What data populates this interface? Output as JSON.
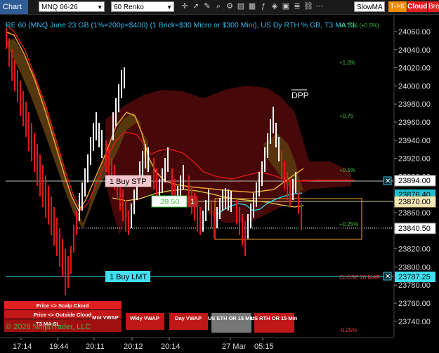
{
  "toolbar": {
    "title": "Chart",
    "instrument": "MNQ 06-26",
    "bar_type": "60 Renko",
    "indicator": "SlowMA",
    "tok_button": "T->K",
    "cloud_button": "Cloud",
    "break_button": "Brea",
    "icons": [
      "crosshair-icon",
      "pointer-icon",
      "draw-icon",
      "zoom-icon",
      "properties-icon",
      "data-box-icon",
      "templates-icon",
      "indicators-icon",
      "strategies-icon",
      "snapshot-icon",
      "dom-icon",
      "link-icon",
      "more-icon"
    ]
  },
  "banner": "RE 60 (MNQ June 23 GB (1%=200p=$400) (1 Brick=$30 Micro or $300 Mini), US Dy RTH % GB, T3 MA SL",
  "percent_labels": [
    "+1.0%",
    "+0.75",
    "+0.5%",
    "+0.25%",
    "-0.25%",
    "CLOSE 26 MAR",
    "+0.75% (+0.5%)"
  ],
  "annotation_dpp": "DPP",
  "orders": {
    "stop_label": "1 Buy STP",
    "stop_price": "23894.00",
    "limit_label": "1 Buy LMT",
    "limit_price": "23787.25",
    "position_pnl": "29.50",
    "position_qty": "1"
  },
  "price_boxes": {
    "p1": "23876.40",
    "p2": "23870.00",
    "p3": "23840.50"
  },
  "price_axis": [
    "24060.00",
    "24040.00",
    "24020.00",
    "24000.00",
    "23980.00",
    "23960.00",
    "23940.00",
    "23920.00",
    "23900.00",
    "23880.00",
    "23860.00",
    "23840.00",
    "23820.00",
    "23800.00",
    "23780.00",
    "23760.00",
    "23740.00"
  ],
  "time_axis": [
    "17:14",
    "19:44",
    "20:11",
    "20:12",
    "20:14",
    "27 Mar",
    "05:15"
  ],
  "buttons": {
    "scalp_cloud": "Price <> Scalp Cloud",
    "outside_cloud": "Price <> Outside Cloud",
    "t3_ma_sl": "T3 MA SL",
    "mnt_vwap": "Mnt VWAP",
    "wkly_vwap": "Wkly VWAP",
    "day_vwap": "Day VWAP",
    "us_eth": "US ETH OR 15 Min",
    "us_rth": "US RTH OR 15 Min"
  },
  "copyright": "© 2026 NinjaTrader, LLC",
  "colors": {
    "background": "#000000",
    "bull": "#ffffff",
    "bear": "#e01818",
    "orange": "#f0a030",
    "cyan": "#20e0f0",
    "green_text": "#45b445",
    "stop_bg": "#f5c6cb",
    "limit_bg": "#40e0f0"
  }
}
